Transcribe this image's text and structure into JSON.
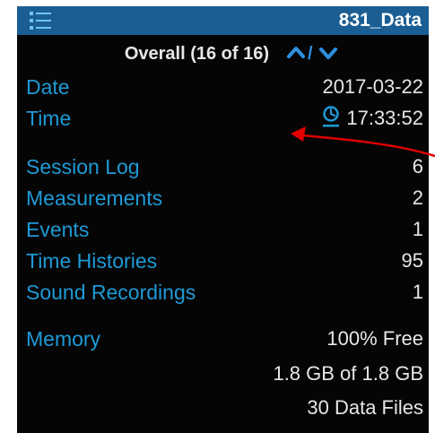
{
  "header": {
    "title": "831_Data",
    "menu_icon": "hamburger-list-icon",
    "bar_color": "#1b5e93"
  },
  "subheader": {
    "label": "Overall (16 of 16)",
    "separator": "/",
    "up_icon": "chevron-up-icon",
    "down_icon": "chevron-down-icon"
  },
  "fields": {
    "date": {
      "label": "Date",
      "value": "2017-03-22"
    },
    "time": {
      "label": "Time",
      "value": "17:33:52",
      "icon": "clock-icon"
    },
    "session_log": {
      "label": "Session Log",
      "value": "6"
    },
    "measurements": {
      "label": "Measurements",
      "value": "2"
    },
    "events": {
      "label": "Events",
      "value": "1"
    },
    "time_histories": {
      "label": "Time Histories",
      "value": "95"
    },
    "sound_recordings": {
      "label": "Sound Recordings",
      "value": "1"
    },
    "memory": {
      "label": "Memory",
      "free": "100% Free",
      "capacity": "1.8 GB of 1.8 GB",
      "files": "30 Data Files"
    }
  },
  "colors": {
    "label_blue": "#1e9ad6",
    "value_text": "#e6e6e6",
    "background": "#050505",
    "annotation_arrow": "#e00000"
  }
}
